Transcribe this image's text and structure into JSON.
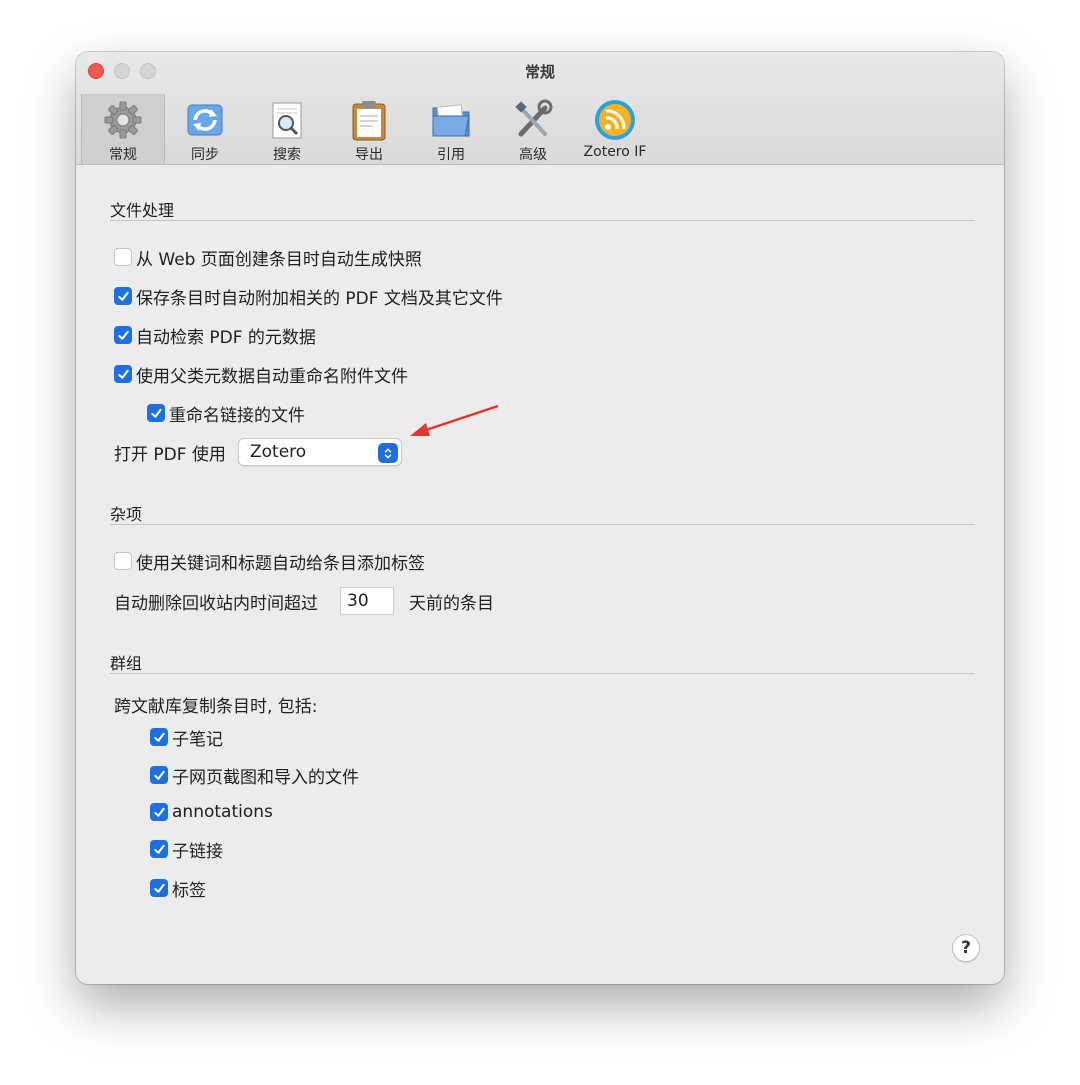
{
  "window": {
    "title": "常规"
  },
  "toolbar": {
    "items": [
      {
        "label": "常规",
        "icon": "gear-icon",
        "selected": true
      },
      {
        "label": "同步",
        "icon": "sync-icon",
        "selected": false
      },
      {
        "label": "搜索",
        "icon": "search-document-icon",
        "selected": false
      },
      {
        "label": "导出",
        "icon": "clipboard-icon",
        "selected": false
      },
      {
        "label": "引用",
        "icon": "folder-icon",
        "selected": false
      },
      {
        "label": "高级",
        "icon": "tools-icon",
        "selected": false
      },
      {
        "label": "Zotero IF",
        "icon": "rss-icon",
        "selected": false
      }
    ]
  },
  "file_handling": {
    "title": "文件处理",
    "options": [
      {
        "label": "从 Web 页面创建条目时自动生成快照",
        "checked": false
      },
      {
        "label": "保存条目时自动附加相关的 PDF 文档及其它文件",
        "checked": true
      },
      {
        "label": "自动检索 PDF 的元数据",
        "checked": true
      },
      {
        "label": "使用父类元数据自动重命名附件文件",
        "checked": true
      },
      {
        "label": "重命名链接的文件",
        "checked": true
      }
    ],
    "open_pdf_label": "打开 PDF 使用",
    "open_pdf_value": "Zotero"
  },
  "misc": {
    "title": "杂项",
    "auto_tag": {
      "label": "使用关键词和标题自动给条目添加标签",
      "checked": false
    },
    "trash_label_before": "自动删除回收站内时间超过",
    "trash_days": "30",
    "trash_label_after": "天前的条目"
  },
  "groups": {
    "title": "群组",
    "copy_label": "跨文献库复制条目时, 包括:",
    "options": [
      {
        "label": "子笔记",
        "checked": true
      },
      {
        "label": "子网页截图和导入的文件",
        "checked": true
      },
      {
        "label": "annotations",
        "checked": true
      },
      {
        "label": "子链接",
        "checked": true
      },
      {
        "label": "标签",
        "checked": true
      }
    ]
  },
  "help_label": "?",
  "colors": {
    "accent": "#1e6fe0",
    "close": "#ee5a52",
    "arrow": "#e0392b"
  }
}
